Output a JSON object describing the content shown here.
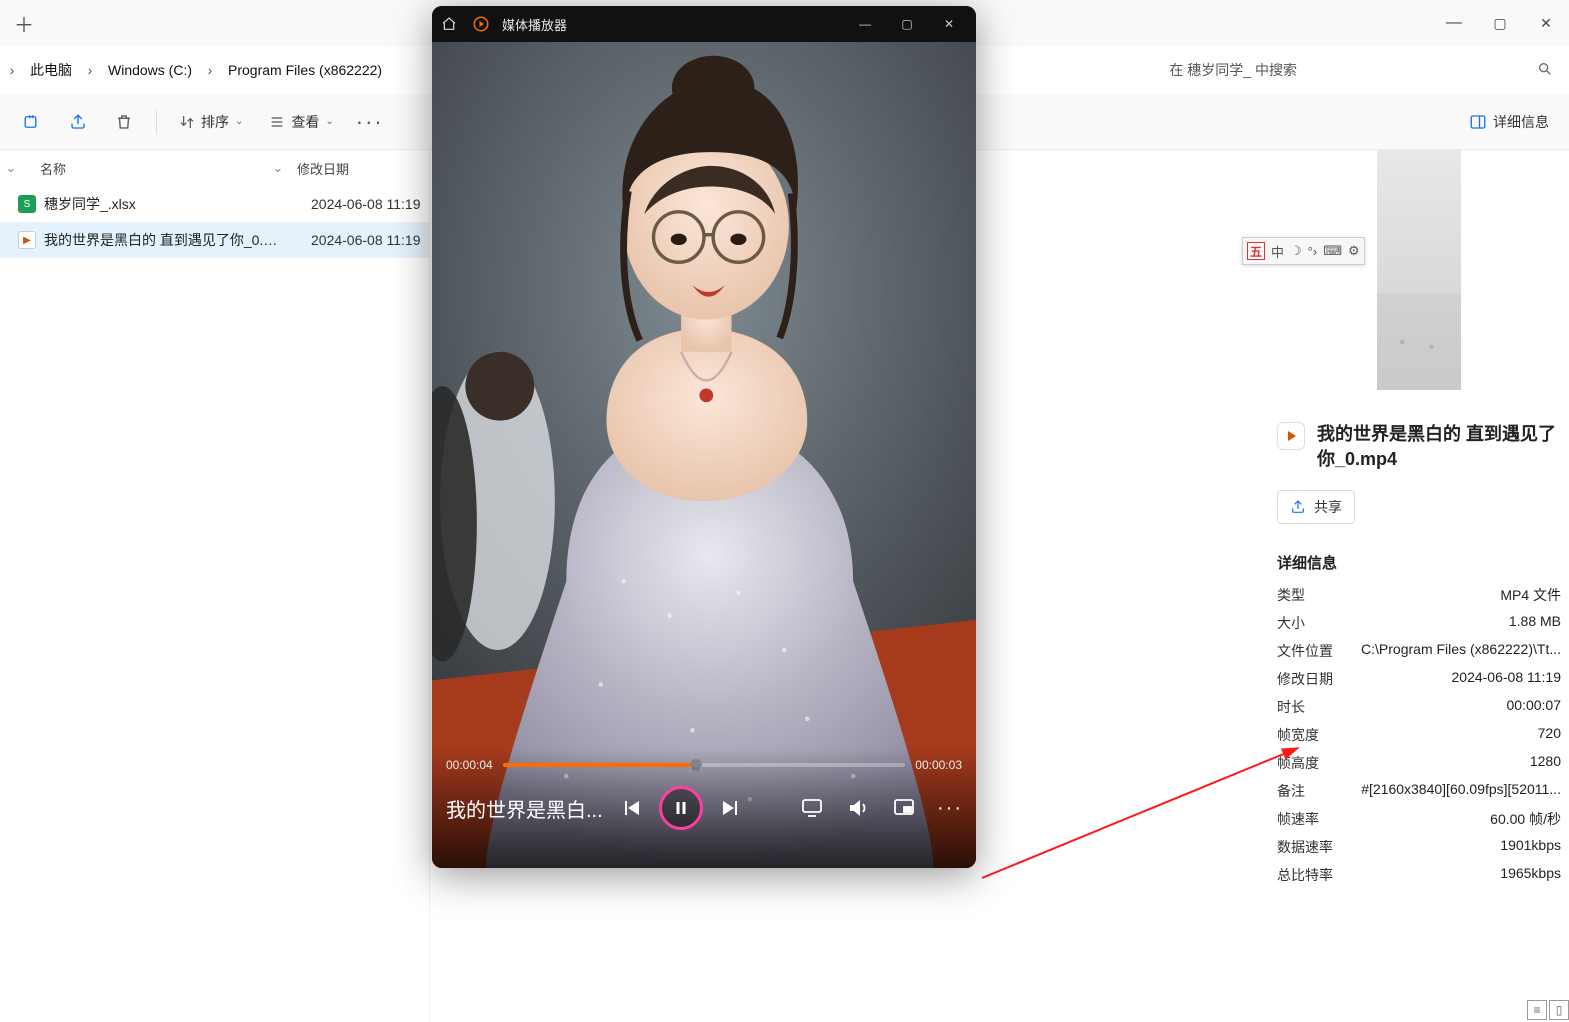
{
  "explorer": {
    "breadcrumb": [
      "此电脑",
      "Windows (C:)",
      "Program Files (x862222)"
    ],
    "search_placeholder": "在 穗岁同学_ 中搜索",
    "toolbar": {
      "sort_label": "排序",
      "view_label": "查看",
      "details_toggle": "详细信息"
    },
    "columns": {
      "name": "名称",
      "modified": "修改日期"
    },
    "files": [
      {
        "icon": "xlsx",
        "name": "穗岁同学_.xlsx",
        "modified": "2024-06-08 11:19",
        "selected": false
      },
      {
        "icon": "mp4",
        "name": "我的世界是黑白的 直到遇见了你_0.mp4",
        "modified": "2024-06-08 11:19",
        "selected": true
      }
    ]
  },
  "details": {
    "filename": "我的世界是黑白的 直到遇见了你_0.mp4",
    "share_label": "共享",
    "section_title": "详细信息",
    "properties": [
      {
        "k": "类型",
        "v": "MP4 文件"
      },
      {
        "k": "大小",
        "v": "1.88 MB"
      },
      {
        "k": "文件位置",
        "v": "C:\\Program Files (x862222)\\Tt..."
      },
      {
        "k": "修改日期",
        "v": "2024-06-08 11:19"
      },
      {
        "k": "时长",
        "v": "00:00:07"
      },
      {
        "k": "帧宽度",
        "v": "720"
      },
      {
        "k": "帧高度",
        "v": "1280"
      },
      {
        "k": "备注",
        "v": "#[2160x3840][60.09fps][52011..."
      },
      {
        "k": "帧速率",
        "v": "60.00 帧/秒"
      },
      {
        "k": "数据速率",
        "v": "1901kbps"
      },
      {
        "k": "总比特率",
        "v": "1965kbps"
      }
    ]
  },
  "ime": {
    "badge": "五",
    "items": [
      "中",
      "",
      "°",
      "",
      ""
    ]
  },
  "player": {
    "app_title": "媒体播放器",
    "current_time": "00:00:04",
    "remaining_time": "00:00:03",
    "progress_percent": 48,
    "now_playing": "我的世界是黑白...",
    "video_description": "Young woman with glasses and updo hairstyle wearing a silver sequined off-shoulder gown and pendant necklace, standing in an indoor venue; two people visible in background; red carpet floor."
  }
}
